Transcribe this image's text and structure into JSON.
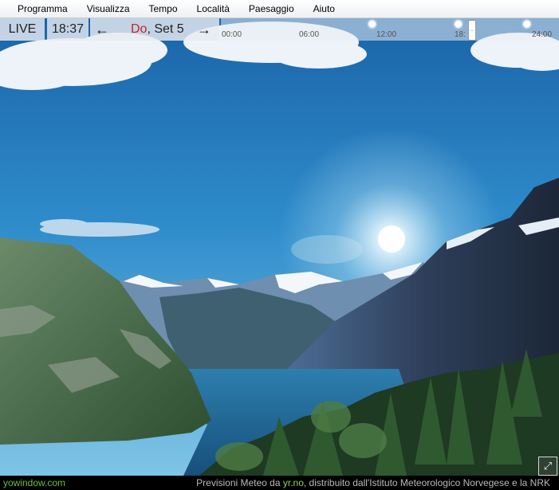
{
  "menu": {
    "items": [
      "Programma",
      "Visualizza",
      "Tempo",
      "Località",
      "Paesaggio",
      "Aiuto"
    ]
  },
  "toolbar": {
    "live_label": "LIVE",
    "time": "18:37",
    "day_abbr": "Do",
    "date_rest": ", Set 5",
    "prev_icon": "arrow-left-icon",
    "next_icon": "arrow-right-icon"
  },
  "timeline": {
    "ticks": [
      "00:00",
      "06:00",
      "12:00",
      "18:",
      "24:00"
    ],
    "slider_position_hours": 18.6,
    "weather_icon": "sun-icon"
  },
  "status": {
    "brand": "yowindow.com",
    "credit_prefix": "Previsioni Meteo da ",
    "credit_link": "yr.no",
    "credit_suffix": ", distribuito dall'Istituto Meteorologico Norvegese e la NRK"
  },
  "colors": {
    "sky_top": "#1a64a8",
    "sky_bottom": "#78c0e6",
    "water": "#1c5e8c",
    "brand": "#6bbf3c",
    "day_abbr": "#c0271c"
  }
}
